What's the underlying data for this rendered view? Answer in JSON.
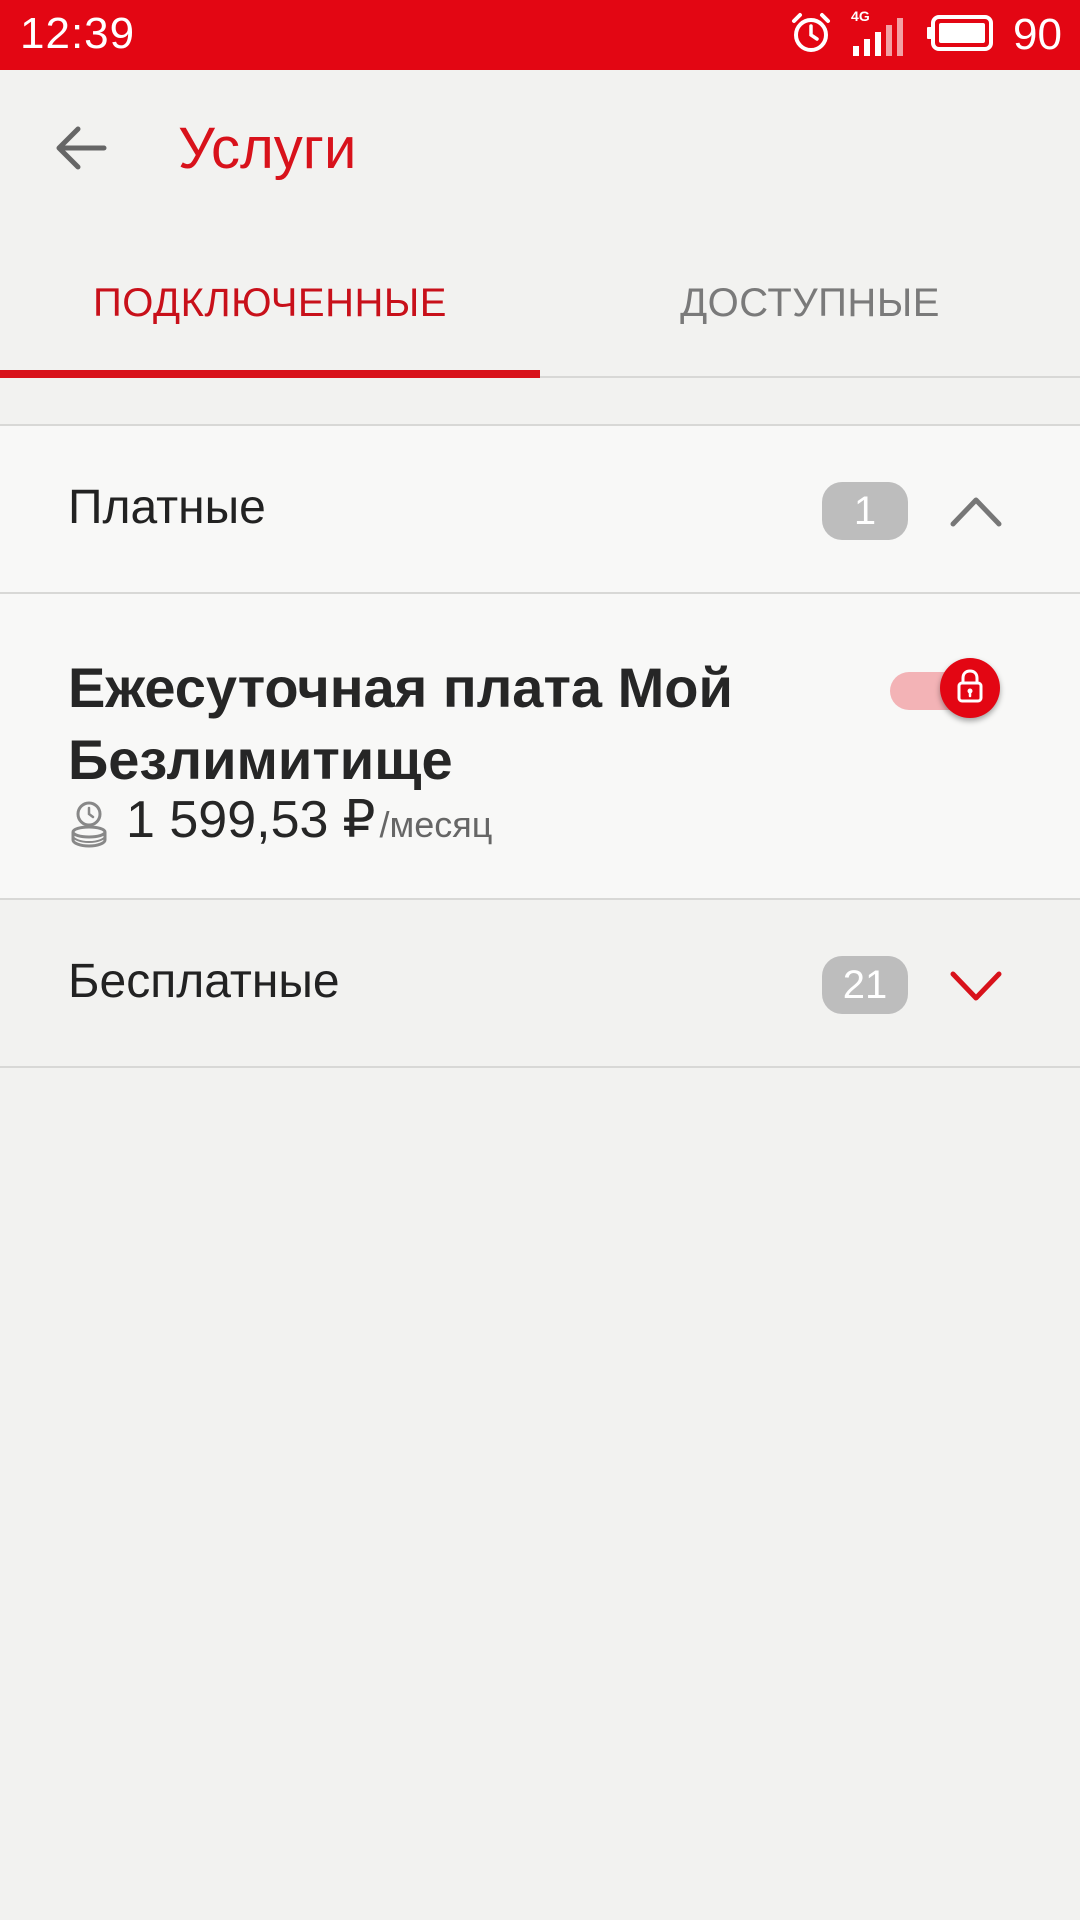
{
  "status_bar": {
    "time": "12:39",
    "network": "4G",
    "battery": "90"
  },
  "app_bar": {
    "title": "Услуги"
  },
  "tabs": [
    {
      "label": "ПОДКЛЮЧЕННЫЕ",
      "active": true
    },
    {
      "label": "ДОСТУПНЫЕ",
      "active": false
    }
  ],
  "sections": {
    "paid": {
      "label": "Платные",
      "count": "1",
      "expanded": true,
      "items": [
        {
          "name": "Ежесуточная плата Мой Безлимитище",
          "price": "1 599,53",
          "currency": "₽",
          "period": "/месяц",
          "toggle_on": true,
          "locked": true
        }
      ]
    },
    "free": {
      "label": "Бесплатные",
      "count": "21",
      "expanded": false
    }
  },
  "colors": {
    "brand_red": "#e30613",
    "title_red": "#d8121b",
    "badge_gray": "#bdbdbd",
    "background": "#f2f2f0"
  },
  "icons": {
    "back": "arrow-left-icon",
    "alarm": "alarm-clock-icon",
    "signal": "signal-icon",
    "battery": "battery-icon",
    "chevron_up": "chevron-up-icon",
    "chevron_down": "chevron-down-icon",
    "lock": "lock-icon",
    "coin": "coin-clock-icon"
  }
}
